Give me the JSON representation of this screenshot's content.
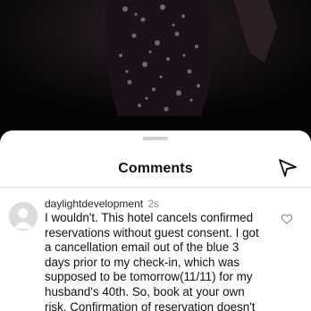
{
  "header": {
    "title": "Comments",
    "send_icon": "send-icon"
  },
  "comment": {
    "username": "daylightdevelopment",
    "time": "2s",
    "text": "I wouldn't. This hotel cancels confirmed reservations without guest consent. I got a cancellation email out of the blue 3 days prior to my check-in, which was supposed to be tomorrow(11/11) for my husband's 40th. So, book at your own risk. Confirmation of reservation doesn't",
    "like_icon": "heart-outline-icon",
    "avatar_icon": "default-avatar-icon"
  },
  "colors": {
    "sheet": "#ffffff",
    "text": "#111111",
    "meta": "#8e8e8e",
    "background": "#000000"
  }
}
